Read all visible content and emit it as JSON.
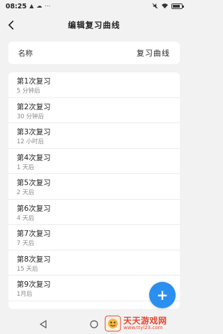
{
  "status_bar": {
    "time": "08:25",
    "battery_level": 0.8
  },
  "header": {
    "title": "编辑复习曲线"
  },
  "name_row": {
    "label": "名称",
    "value": "复习曲线"
  },
  "reviews": [
    {
      "title": "第1次复习",
      "interval": "5 分钟后"
    },
    {
      "title": "第2次复习",
      "interval": "30 分钟后"
    },
    {
      "title": "第3次复习",
      "interval": "12 小时后"
    },
    {
      "title": "第4次复习",
      "interval": "1 天后"
    },
    {
      "title": "第5次复习",
      "interval": "2 天后"
    },
    {
      "title": "第6次复习",
      "interval": "4 天后"
    },
    {
      "title": "第7次复习",
      "interval": "7 天后"
    },
    {
      "title": "第8次复习",
      "interval": "15 天后"
    },
    {
      "title": "第9次复习",
      "interval": "1月后"
    }
  ],
  "fab": {
    "label": "+"
  },
  "watermark": {
    "main": "天天游戏网",
    "url": "www.ttyl23.com"
  },
  "colors": {
    "accent": "#2b8ff0",
    "watermark": "#e8442c"
  }
}
